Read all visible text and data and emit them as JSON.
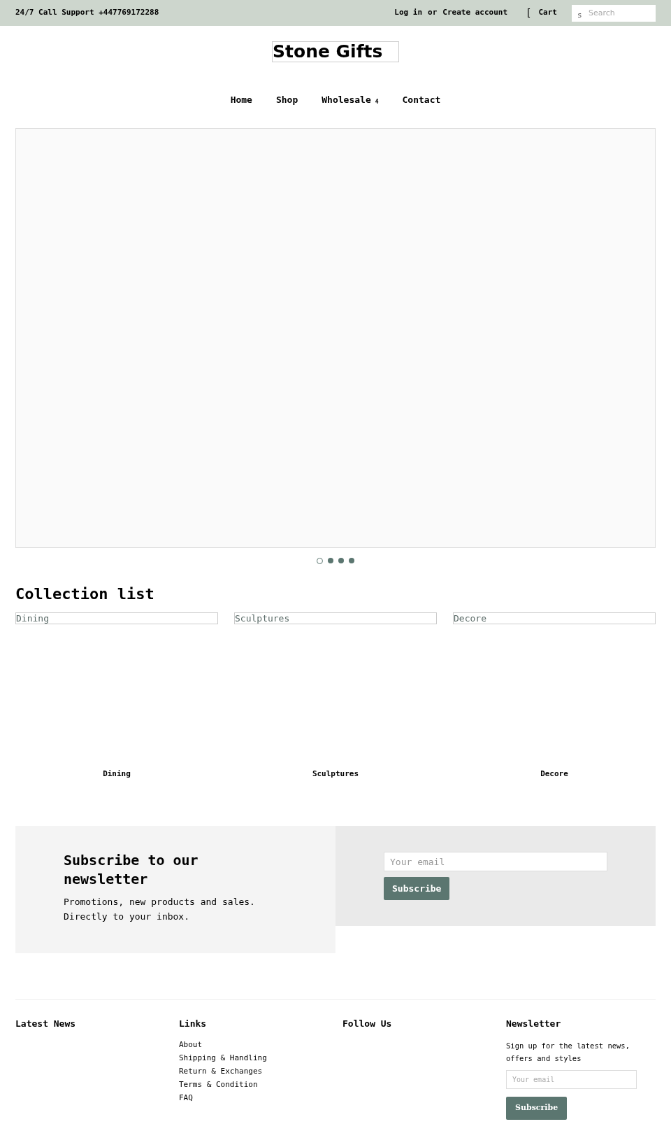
{
  "top_bar": {
    "support": "24/7 Call Support +447769172288",
    "login": "Log in",
    "or": "or",
    "create_account": "Create account",
    "cart_glyph": "[",
    "cart": "Cart",
    "search_glyph": "s",
    "search_placeholder": "Search"
  },
  "logo": "Stone Gifts",
  "nav": [
    {
      "label": "Home"
    },
    {
      "label": "Shop"
    },
    {
      "label": "Wholesale",
      "caret": "4"
    },
    {
      "label": "Contact"
    }
  ],
  "slideshow": {
    "dots": [
      {
        "selected": true
      },
      {
        "selected": false
      },
      {
        "selected": false
      },
      {
        "selected": false
      }
    ]
  },
  "collection_list": {
    "title": "Collection list",
    "items": [
      {
        "image_alt": "Dining",
        "title": "Dining"
      },
      {
        "image_alt": "Sculptures",
        "title": "Sculptures"
      },
      {
        "image_alt": "Decore",
        "title": "Decore"
      }
    ]
  },
  "newsletter": {
    "title": "Subscribe to our newsletter",
    "text": "Promotions, new products and sales. Directly to your inbox.",
    "placeholder": "Your email",
    "button": "Subscribe"
  },
  "footer": {
    "columns": [
      {
        "title": "Latest News"
      },
      {
        "title": "Links",
        "links": [
          "About",
          "Shipping & Handling",
          "Return & Exchanges",
          "Terms & Condition",
          "FAQ"
        ]
      },
      {
        "title": "Follow Us"
      },
      {
        "title": "Newsletter",
        "text": "Sign up for the latest news, offers and styles",
        "placeholder": "Your email",
        "button": "Subscribe"
      }
    ]
  }
}
